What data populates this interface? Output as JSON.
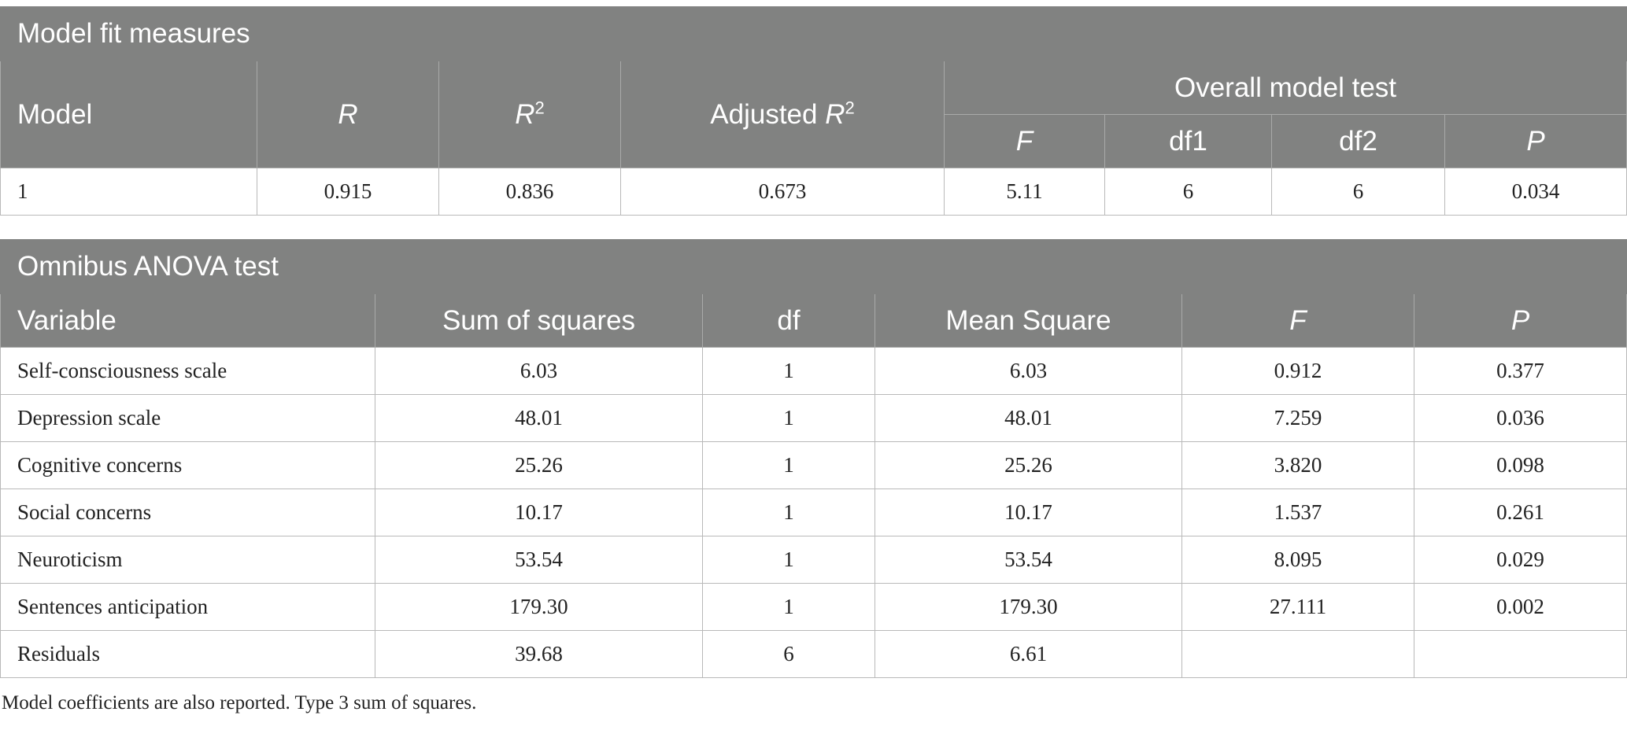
{
  "fit": {
    "title": "Model fit measures",
    "headers": {
      "model": "Model",
      "r": "R",
      "r2_base": "R",
      "r2_sup": "2",
      "adj_prefix": "Adjusted ",
      "adj_base": "R",
      "adj_sup": "2",
      "overall": "Overall model test",
      "f": "F",
      "df1": "df1",
      "df2": "df2",
      "p": "P"
    },
    "row": {
      "model": "1",
      "r": "0.915",
      "r2": "0.836",
      "adj_r2": "0.673",
      "f": "5.11",
      "df1": "6",
      "df2": "6",
      "p": "0.034"
    }
  },
  "anova": {
    "title": "Omnibus ANOVA test",
    "headers": {
      "variable": "Variable",
      "ss": "Sum of squares",
      "df": "df",
      "ms": "Mean Square",
      "f": "F",
      "p": "P"
    },
    "rows": [
      {
        "variable": "Self-consciousness scale",
        "ss": "6.03",
        "df": "1",
        "ms": "6.03",
        "f": "0.912",
        "p": "0.377"
      },
      {
        "variable": "Depression scale",
        "ss": "48.01",
        "df": "1",
        "ms": "48.01",
        "f": "7.259",
        "p": "0.036"
      },
      {
        "variable": "Cognitive concerns",
        "ss": "25.26",
        "df": "1",
        "ms": "25.26",
        "f": "3.820",
        "p": "0.098"
      },
      {
        "variable": "Social concerns",
        "ss": "10.17",
        "df": "1",
        "ms": "10.17",
        "f": "1.537",
        "p": "0.261"
      },
      {
        "variable": "Neuroticism",
        "ss": "53.54",
        "df": "1",
        "ms": "53.54",
        "f": "8.095",
        "p": "0.029"
      },
      {
        "variable": "Sentences anticipation",
        "ss": "179.30",
        "df": "1",
        "ms": "179.30",
        "f": "27.111",
        "p": "0.002"
      },
      {
        "variable": "Residuals",
        "ss": "39.68",
        "df": "6",
        "ms": "6.61",
        "f": "",
        "p": ""
      }
    ]
  },
  "footnote": "Model coefficients are also reported. Type 3 sum of squares."
}
